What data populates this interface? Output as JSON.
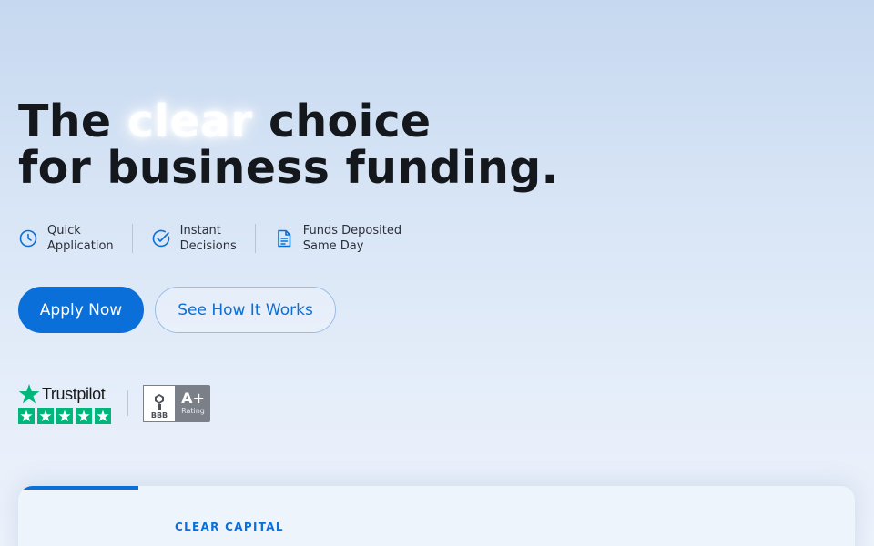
{
  "hero": {
    "headline_before": "The ",
    "headline_highlight": "clear",
    "headline_after": " choice",
    "headline_line2": "for business funding."
  },
  "features": [
    {
      "icon": "clock-icon",
      "line1": "Quick",
      "line2": "Application"
    },
    {
      "icon": "check-circle-icon",
      "line1": "Instant",
      "line2": "Decisions"
    },
    {
      "icon": "document-icon",
      "line1": "Funds Deposited",
      "line2": "Same Day"
    }
  ],
  "buttons": {
    "primary_label": "Apply Now",
    "secondary_label": "See How It Works"
  },
  "badges": {
    "trustpilot_name": "Trustpilot",
    "trustpilot_stars": 5,
    "bbb_label": "BBB",
    "bbb_grade": "A+",
    "bbb_rating_label": "Rating"
  },
  "card": {
    "eyebrow": "CLEAR CAPITAL"
  },
  "colors": {
    "accent": "#0a6fd8",
    "trustpilot_green": "#00b67a",
    "bbb_gray": "#7a7f88",
    "headline": "#14171c"
  }
}
